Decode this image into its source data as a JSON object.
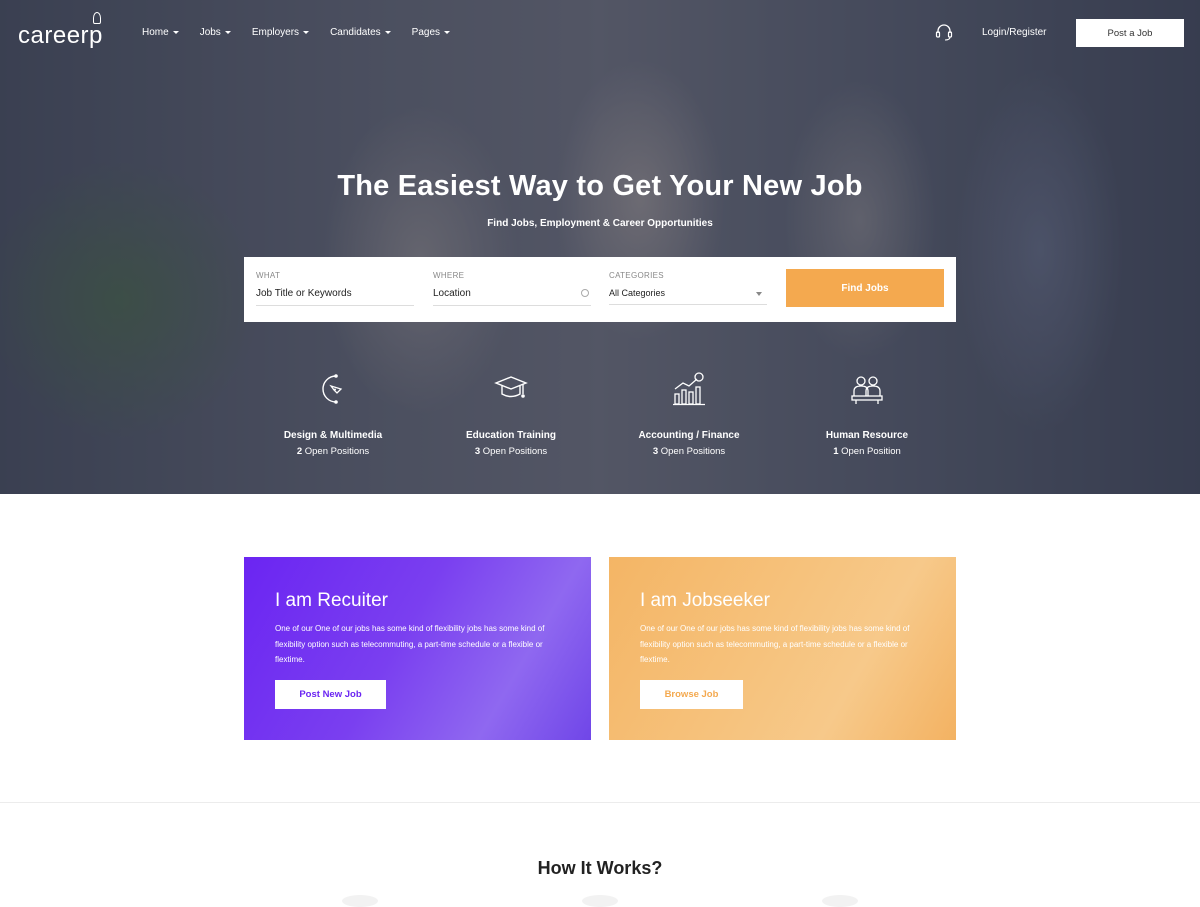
{
  "brand": {
    "logo": "career",
    "logo_tail": "p"
  },
  "nav": {
    "items": [
      {
        "label": "Home"
      },
      {
        "label": "Jobs"
      },
      {
        "label": "Employers"
      },
      {
        "label": "Candidates"
      },
      {
        "label": "Pages"
      }
    ],
    "login_label": "Login/Register",
    "post_job_label": "Post a Job"
  },
  "hero": {
    "title": "The Easiest Way to Get Your New Job",
    "subtitle": "Find Jobs, Employment & Career Opportunities"
  },
  "search": {
    "what_label": "WHAT",
    "what_placeholder": "Job Title or Keywords",
    "where_label": "WHERE",
    "where_placeholder": "Location",
    "categories_label": "CATEGORIES",
    "categories_value": "All Categories",
    "button_label": "Find Jobs"
  },
  "categories": [
    {
      "name": "Design & Multimedia",
      "count": "2",
      "suffix": "Open Positions",
      "icon": "pen-tool-icon"
    },
    {
      "name": "Education Training",
      "count": "3",
      "suffix": "Open Positions",
      "icon": "graduation-cap-icon"
    },
    {
      "name": "Accounting / Finance",
      "count": "3",
      "suffix": "Open Positions",
      "icon": "finance-chart-icon"
    },
    {
      "name": "Human Resource",
      "count": "1",
      "suffix": "Open Position",
      "icon": "people-icon"
    }
  ],
  "cards": {
    "recruiter": {
      "title": "I am Recuiter",
      "text": "One of our One of our jobs has some kind of flexibility jobs has some kind of flexibility option such as telecommuting, a part-time schedule or a flexible or flextime.",
      "button": "Post New Job",
      "color": "#6b25f2"
    },
    "seeker": {
      "title": "I am Jobseeker",
      "text": "One of our One of our jobs has some kind of flexibility jobs has some kind of flexibility option such as telecommuting, a part-time schedule or a flexible or flextime.",
      "button": "Browse Job",
      "color": "#f4a94f"
    }
  },
  "how_it_works": {
    "title": "How It Works?"
  }
}
